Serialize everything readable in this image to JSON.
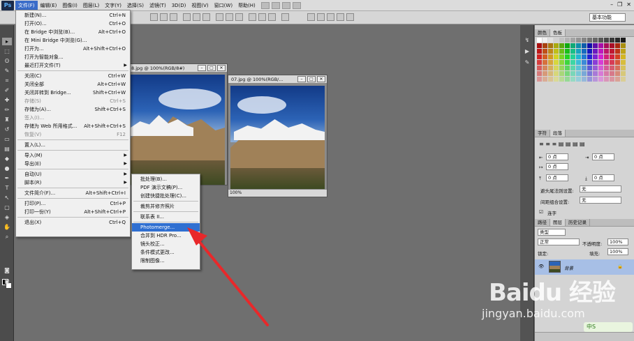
{
  "app": {
    "logo": "Ps",
    "workspace": "基本功能"
  },
  "menubar": [
    "文件(F)",
    "编辑(E)",
    "图像(I)",
    "图层(L)",
    "文字(Y)",
    "选择(S)",
    "滤镜(T)",
    "3D(D)",
    "视图(V)",
    "窗口(W)",
    "帮助(H)"
  ],
  "file_menu": {
    "items": [
      {
        "label": "新建(N)...",
        "shortcut": "Ctrl+N"
      },
      {
        "label": "打开(O)...",
        "shortcut": "Ctrl+O"
      },
      {
        "label": "在 Bridge 中浏览(B)...",
        "shortcut": "Alt+Ctrl+O"
      },
      {
        "label": "在 Mini Bridge 中浏览(G)...",
        "shortcut": ""
      },
      {
        "label": "打开为...",
        "shortcut": "Alt+Shift+Ctrl+O"
      },
      {
        "label": "打开为智能对象...",
        "shortcut": ""
      },
      {
        "label": "最近打开文件(T)",
        "shortcut": ""
      },
      {
        "label": "关闭(C)",
        "shortcut": "Ctrl+W"
      },
      {
        "label": "关闭全部",
        "shortcut": "Alt+Ctrl+W"
      },
      {
        "label": "关闭并转到 Bridge...",
        "shortcut": "Shift+Ctrl+W"
      },
      {
        "label": "存储(S)",
        "shortcut": "Ctrl+S"
      },
      {
        "label": "存储为(A)...",
        "shortcut": "Shift+Ctrl+S"
      },
      {
        "label": "签入(I)...",
        "shortcut": ""
      },
      {
        "label": "存储为 Web 所用格式...",
        "shortcut": "Alt+Shift+Ctrl+S"
      },
      {
        "label": "恢复(V)",
        "shortcut": "F12"
      },
      {
        "label": "置入(L)...",
        "shortcut": ""
      },
      {
        "label": "导入(M)",
        "shortcut": ""
      },
      {
        "label": "导出(E)",
        "shortcut": ""
      },
      {
        "label": "自动(U)",
        "shortcut": ""
      },
      {
        "label": "脚本(R)",
        "shortcut": ""
      },
      {
        "label": "文件简介(F)...",
        "shortcut": "Alt+Shift+Ctrl+I"
      },
      {
        "label": "打印(P)...",
        "shortcut": "Ctrl+P"
      },
      {
        "label": "打印一份(Y)",
        "shortcut": "Alt+Shift+Ctrl+P"
      },
      {
        "label": "退出(X)",
        "shortcut": "Ctrl+Q"
      }
    ]
  },
  "auto_submenu": [
    "批处理(B)...",
    "PDF 演示文稿(P)...",
    "创建快捷批处理(C)...",
    "裁剪并修齐照片",
    "联系表 II...",
    "Photomerge...",
    "合并到 HDR Pro...",
    "镜头校正...",
    "条件模式更改...",
    "限制图像..."
  ],
  "docs": [
    {
      "title": "8.jpg @ 100%(RGB/8#)",
      "zoom": ""
    },
    {
      "title": "07.jpg @ 100%(RGB/...",
      "zoom": "100%"
    }
  ],
  "panels": {
    "color_tabs": [
      "颜色",
      "色板"
    ],
    "para_tabs": [
      "字符",
      "段落"
    ],
    "para_fields": [
      "0 点",
      "0 点",
      "0 点",
      "0 点",
      "0 点"
    ],
    "avoid_label": "避头尾法则设置:",
    "avoid_value": "无",
    "compose_label": "间距组合设置:",
    "compose_value": "无",
    "hyphen_label": "连字",
    "layers_tabs": [
      "路径",
      "图层",
      "历史记录"
    ],
    "kind_label": "类型",
    "blend_mode": "正常",
    "opacity_label": "不透明度:",
    "opacity_value": "100%",
    "lock_label": "锁定:",
    "fill_label": "填充:",
    "fill_value": "100%",
    "layer_name": "背景"
  },
  "watermark": {
    "brand": "Baidu 经验",
    "url": "jingyan.baidu.com",
    "badge": "中S"
  },
  "colors": {
    "menu_highlight": "#2f6fd1",
    "arrow": "#e8282a",
    "layer_selected": "#a7bfe6"
  }
}
